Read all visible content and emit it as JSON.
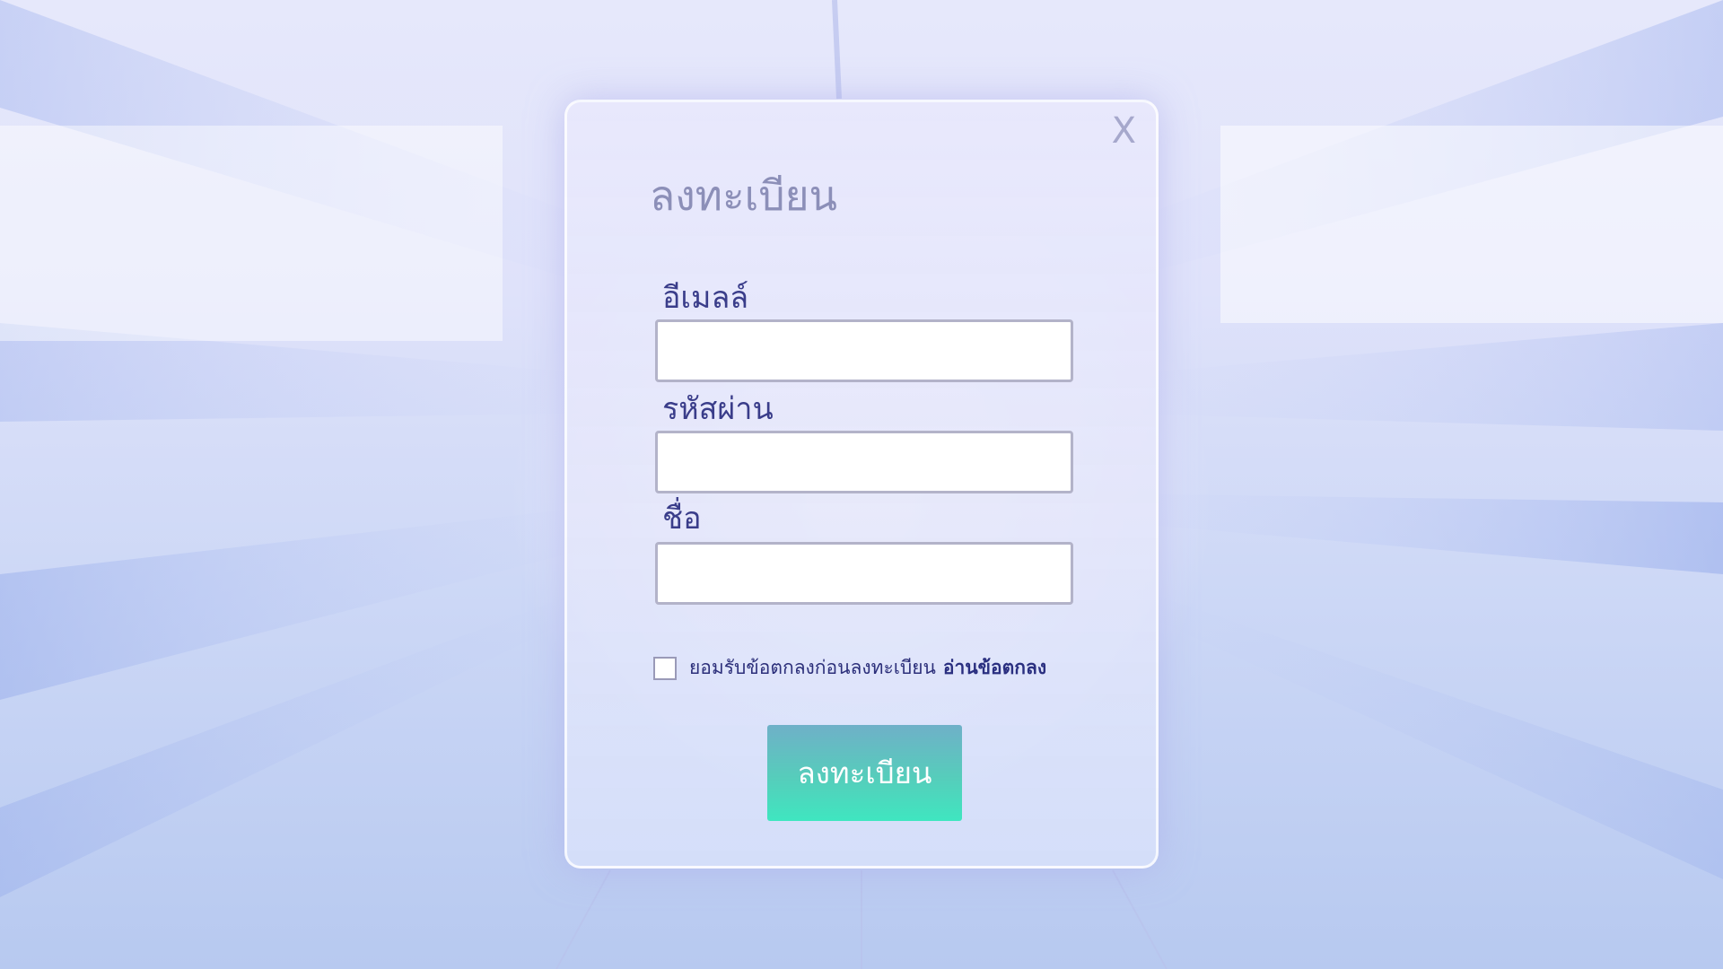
{
  "dialog": {
    "close_label": "X",
    "title": "ลงทะเบียน",
    "fields": {
      "email": {
        "label": "อีเมลล์",
        "value": ""
      },
      "password": {
        "label": "รหัสผ่าน",
        "value": ""
      },
      "name": {
        "label": "ชื่อ",
        "value": ""
      }
    },
    "agree_text": "ยอมรับข้อตกลงก่อนลงทะเบียน",
    "agree_link": "อ่านข้อตกลง",
    "agree_checked": false,
    "submit_label": "ลงทะเบียน"
  },
  "colors": {
    "title": "#8c8fb8",
    "label": "#3a3d8a",
    "button_top": "#6fb0c8",
    "button_bottom": "#3fe6c0",
    "link": "#2a2f80"
  }
}
